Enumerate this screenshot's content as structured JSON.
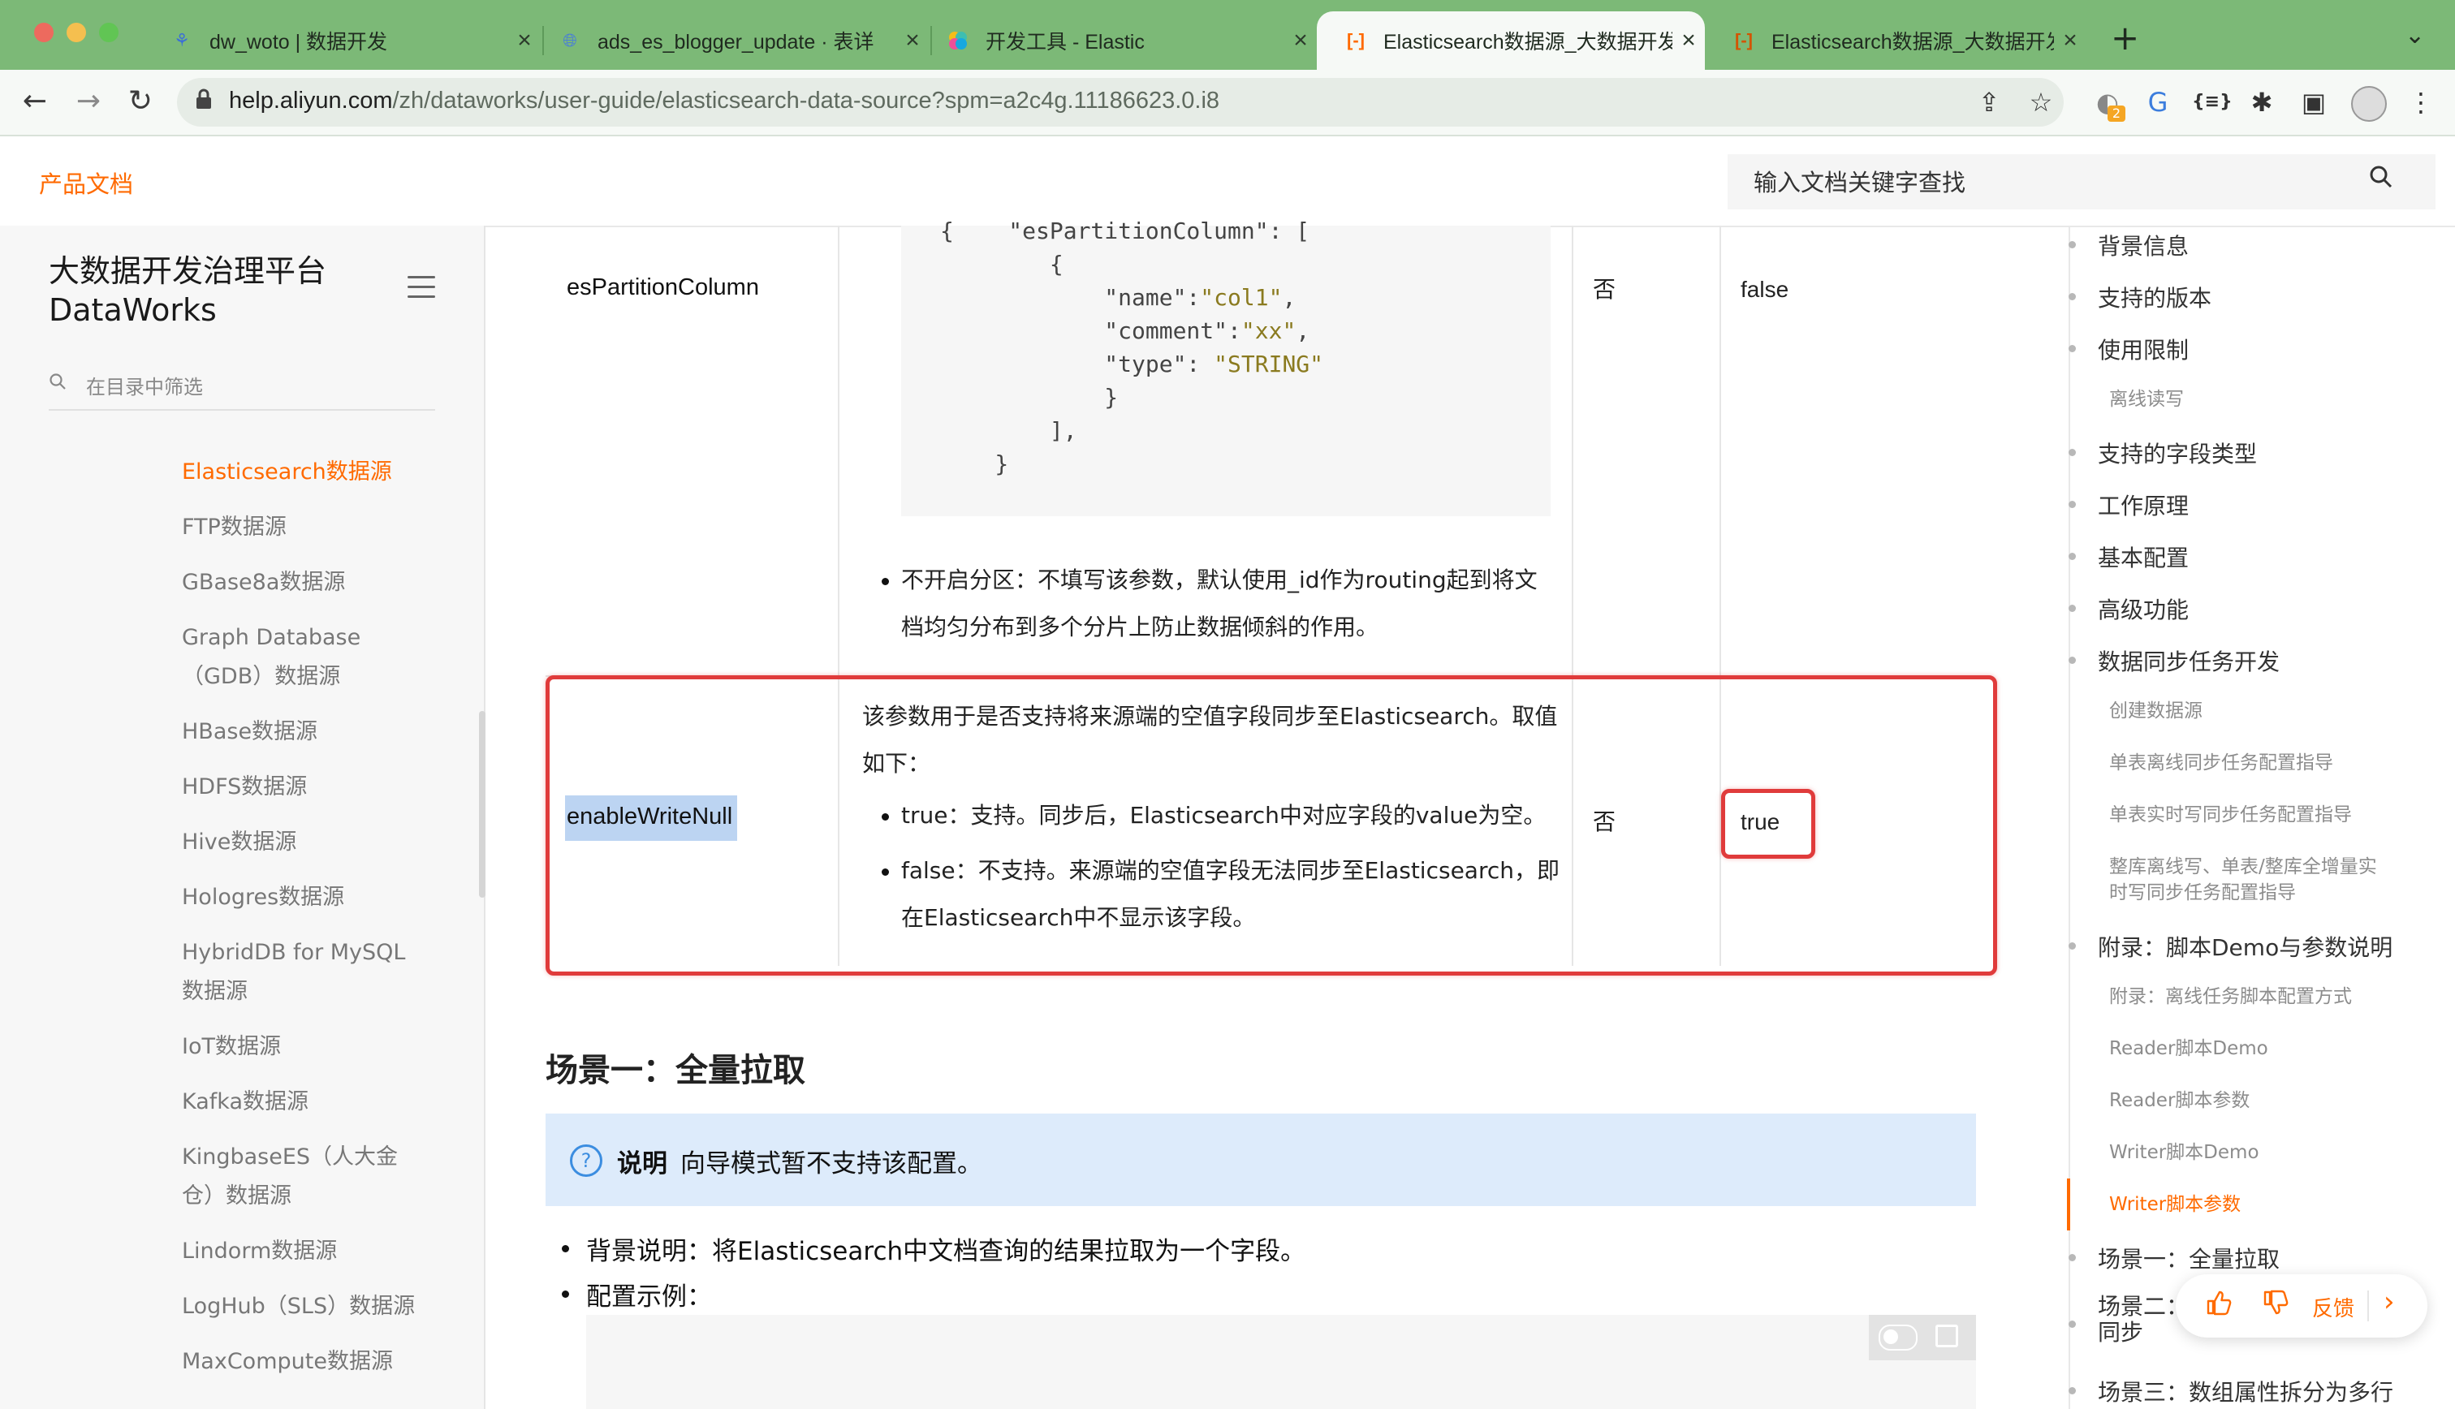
{
  "browser": {
    "tabs": [
      {
        "icon": "dataworks-icon",
        "title": "dw_woto | 数据开发"
      },
      {
        "icon": "globe-icon",
        "title": "ads_es_blogger_update · 表详"
      },
      {
        "icon": "elastic-icon",
        "title": "开发工具 - Elastic"
      },
      {
        "icon": "aliyun-icon",
        "title": "Elasticsearch数据源_大数据开发"
      },
      {
        "icon": "aliyun-icon",
        "title": "Elasticsearch数据源_大数据开发"
      }
    ],
    "active_tab_index": 3,
    "url_host": "help.aliyun.com",
    "url_path": "/zh/dataworks/user-guide/elasticsearch-data-source?spm=a2c4g.11186623.0.i8",
    "extension_badge": "2"
  },
  "header": {
    "brand": "产品文档",
    "search_placeholder": "输入文档关键字查找"
  },
  "sidebar": {
    "product_title_line1": "大数据开发治理平台",
    "product_title_line2": "DataWorks",
    "filter_placeholder": "在目录中筛选",
    "items": [
      {
        "label": "Elasticsearch数据源",
        "active": true
      },
      {
        "label": "FTP数据源"
      },
      {
        "label": "GBase8a数据源"
      },
      {
        "label": "Graph Database（GDB）数据源"
      },
      {
        "label": "HBase数据源"
      },
      {
        "label": "HDFS数据源"
      },
      {
        "label": "Hive数据源"
      },
      {
        "label": "Hologres数据源"
      },
      {
        "label": "HybridDB for MySQL数据源"
      },
      {
        "label": "IoT数据源"
      },
      {
        "label": "Kafka数据源"
      },
      {
        "label": "KingbaseES（人大金仓）数据源"
      },
      {
        "label": "Lindorm数据源"
      },
      {
        "label": "LogHub（SLS）数据源"
      },
      {
        "label": "MaxCompute数据源"
      }
    ]
  },
  "table": {
    "row1": {
      "name": "esPartitionColumn",
      "code_lines": [
        "{    \"esPartitionColumn\": [",
        "        {",
        "            \"name\":\"col1\",",
        "            \"comment\":\"xx\",",
        "            \"type\": \"STRING\"",
        "            }",
        "        ],",
        "    }"
      ],
      "bullet": "不开启分区：不填写该参数，默认使用_id作为routing起到将文档均匀分布到多个分片上防止数据倾斜的作用。",
      "bullet_line1": "不开启分区：不填写该参数，默认使用_id作为routing起到将文",
      "bullet_line2": "档均匀分布到多个分片上防止数据倾斜的作用。",
      "required": "否",
      "default": "false"
    },
    "row2": {
      "name": "enableWriteNull",
      "desc_line1": "该参数用于是否支持将来源端的空值字段同步至Elasticsearch。取值",
      "desc_line2": "如下：",
      "bullet1": "true：支持。同步后，Elasticsearch中对应字段的value为空。",
      "bullet2_line1": "false：不支持。来源端的空值字段无法同步至Elasticsearch，即",
      "bullet2_line2": "在Elasticsearch中不显示该字段。",
      "required": "否",
      "default": "true"
    }
  },
  "main": {
    "scene1_title": "场景一：全量拉取",
    "note_label": "说明",
    "note_text": "向导模式暂不支持该配置。",
    "bullet_bg": "背景说明：将Elasticsearch中文档查询的结果拉取为一个字段。",
    "bullet_cfg": "配置示例："
  },
  "toc": {
    "items": [
      {
        "label": "背景信息",
        "level": 1
      },
      {
        "label": "支持的版本",
        "level": 1
      },
      {
        "label": "使用限制",
        "level": 1
      },
      {
        "label": "离线读写",
        "level": 2
      },
      {
        "label": "支持的字段类型",
        "level": 1
      },
      {
        "label": "工作原理",
        "level": 1
      },
      {
        "label": "基本配置",
        "level": 1
      },
      {
        "label": "高级功能",
        "level": 1
      },
      {
        "label": "数据同步任务开发",
        "level": 1
      },
      {
        "label": "创建数据源",
        "level": 2
      },
      {
        "label": "单表离线同步任务配置指导",
        "level": 2
      },
      {
        "label": "单表实时写同步任务配置指导",
        "level": 2
      },
      {
        "label": "整库离线写、单表/整库全增量实时写同步任务配置指导",
        "level": 2
      },
      {
        "label": "附录：脚本Demo与参数说明",
        "level": 1
      },
      {
        "label": "附录：离线任务脚本配置方式",
        "level": 2
      },
      {
        "label": "Reader脚本Demo",
        "level": 2
      },
      {
        "label": "Reader脚本参数",
        "level": 2
      },
      {
        "label": "Writer脚本Demo",
        "level": 2
      },
      {
        "label": "Writer脚本参数",
        "level": 2,
        "active": true
      },
      {
        "label": "场景一：全量拉取",
        "level": 1
      },
      {
        "label": "场景二：同步",
        "level": 1
      },
      {
        "label": "场景三：数组属性拆分为多行",
        "level": 1
      }
    ],
    "toc_13_line1": "整库离线写、单表/整库全增量实",
    "toc_13_line2": "时写同步任务配置指导",
    "toc_21_line1": "场景二：",
    "toc_21_line2": "同步"
  },
  "feedback": {
    "label": "反馈"
  },
  "colors": {
    "accent": "#ff6a00",
    "highlight_border": "#e03b3b",
    "tab_bar": "#7cb977"
  }
}
